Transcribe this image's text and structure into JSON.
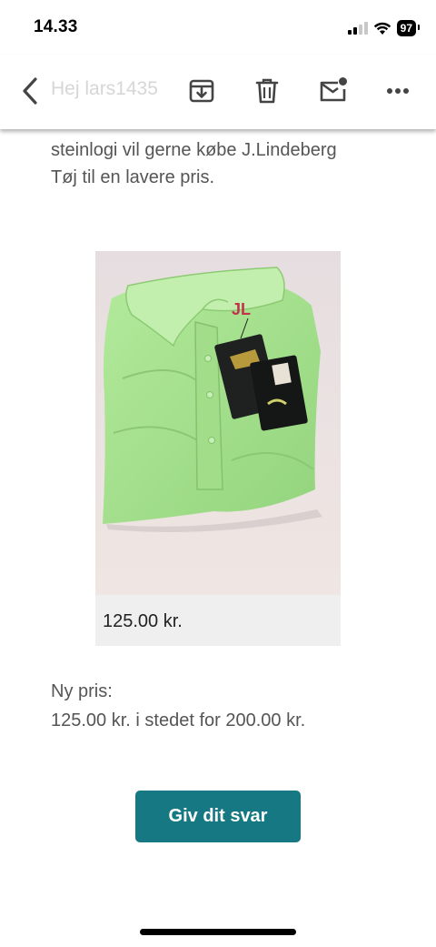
{
  "status": {
    "time": "14.33",
    "battery": "97"
  },
  "toolbar": {
    "title": "Hej lars1435"
  },
  "message": {
    "intro_line1": "steinlogi vil gerne købe J.Lindeberg",
    "intro_line2": "Tøj til en lavere pris.",
    "product": {
      "price": "125.00 kr.",
      "brand_mark": "JL"
    },
    "new_price_label": "Ny pris:",
    "new_price_text": "125.00 kr. i stedet for 200.00 kr.",
    "reply_button": "Giv dit svar"
  },
  "colors": {
    "accent": "#157882",
    "shirt": "#a6e290"
  }
}
